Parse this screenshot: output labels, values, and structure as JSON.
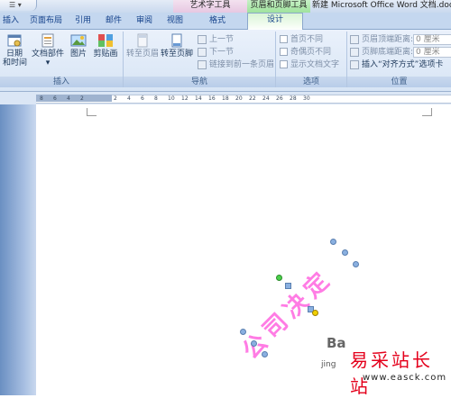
{
  "titlebar": {
    "context_tab_arttext": "艺术字工具",
    "context_tab_header": "页眉和页脚工具",
    "document_title": "新建 Microsoft Office Word 文档.doc"
  },
  "tabs": [
    "插入",
    "页面布局",
    "引用",
    "邮件",
    "审阅",
    "视图",
    "格式",
    "设计"
  ],
  "active_tab": "设计",
  "groups": {
    "insert": {
      "label": "插入",
      "datetime": "日期\n和时间",
      "docparts": "文档部件",
      "picture": "图片",
      "clipart": "剪贴画"
    },
    "navigation": {
      "label": "导航",
      "goto_header": "转至页眉",
      "goto_footer": "转至页脚",
      "previous": "上一节",
      "next": "下一节",
      "link_previous": "链接到前一条页眉"
    },
    "options": {
      "label": "选项",
      "first_page": "首页不同",
      "odd_even": "奇偶页不同",
      "show_text": "显示文档文字"
    },
    "position": {
      "label": "位置",
      "header_from_top": "页眉顶端距离:",
      "footer_from_bottom": "页脚底端距离:",
      "insert_align_tab": "插入“对齐方式”选项卡",
      "header_value": "0 厘米",
      "footer_value": "0 厘米"
    }
  },
  "ruler": {
    "ticks": [
      "8",
      "6",
      "4",
      "2",
      "2",
      "4",
      "6",
      "8",
      "10",
      "12",
      "14",
      "16",
      "18",
      "20",
      "22",
      "24",
      "26",
      "28",
      "30"
    ]
  },
  "document": {
    "wordart_text": "公司决定"
  },
  "watermark": {
    "logo": "Ba",
    "sub": "jing",
    "site_name": "易采站长站",
    "url": "www.easck.com"
  }
}
